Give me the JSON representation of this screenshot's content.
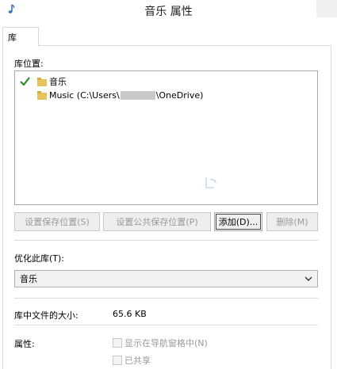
{
  "window": {
    "title": "音乐 属性"
  },
  "tabs": [
    {
      "label": "库"
    }
  ],
  "library_locations": {
    "label": "库位置:",
    "items": [
      {
        "label": "音乐"
      },
      {
        "label_prefix": "Music (C:\\Users\\",
        "label_suffix": "\\OneDrive)"
      }
    ]
  },
  "buttons": {
    "set_save_location": "设置保存位置(S)",
    "set_public_save_location": "设置公共保存位置(P)",
    "add": "添加(D)...",
    "remove": "删除(M)"
  },
  "optimize": {
    "label": "优化此库(T):",
    "selected": "音乐"
  },
  "size": {
    "label": "库中文件的大小:",
    "value": "65.6 KB"
  },
  "attributes": {
    "label": "属性:",
    "show_in_nav": "显示在导航窗格中(N)",
    "shared": "已共享"
  }
}
